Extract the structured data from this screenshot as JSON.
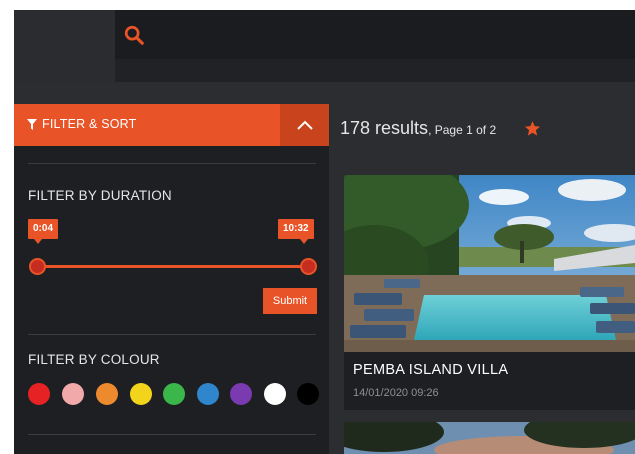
{
  "search": {
    "placeholder": ""
  },
  "filter": {
    "title": "FILTER & SORT",
    "duration": {
      "title": "FILTER BY DURATION",
      "min_label": "0:04",
      "max_label": "10:32",
      "submit_label": "Submit"
    },
    "colour": {
      "title": "FILTER BY COLOUR",
      "swatches": [
        "#e62224",
        "#f1a9a9",
        "#ed8a2e",
        "#f2d41a",
        "#3ab64a",
        "#2f86cc",
        "#7a3ab0",
        "#ffffff",
        "#000000"
      ]
    }
  },
  "results": {
    "count": "178 results",
    "page": ", Page 1 of 2"
  },
  "cards": [
    {
      "title": "PEMBA ISLAND VILLA",
      "date": "14/01/2020 09:26"
    }
  ],
  "colors": {
    "accent": "#e85427",
    "panel": "#1d1f22",
    "background": "#2b2d30"
  }
}
